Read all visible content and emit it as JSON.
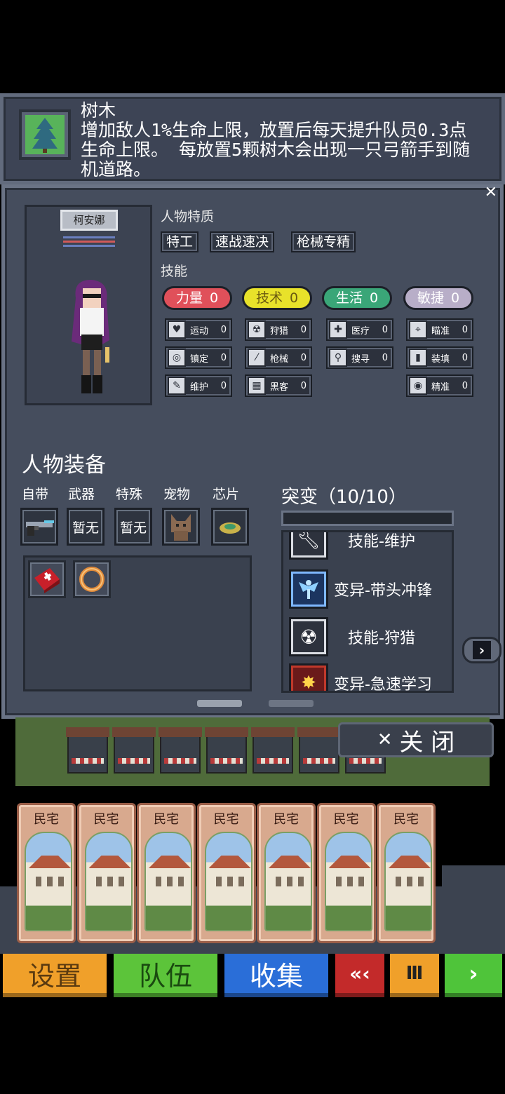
{
  "tooltip": {
    "icon": "tree-icon",
    "title": "树木",
    "description": "增加敌人1%生命上限，放置后每天提升队员0.3点生命上限。 每放置5颗树木会出现一只弓箭手到随机道路。"
  },
  "character": {
    "name": "柯安娜",
    "traits_label": "人物特质",
    "traits": [
      "特工",
      "速战速决",
      "枪械专精"
    ],
    "skills_label": "技能",
    "stats": [
      {
        "label": "力量",
        "value": "0",
        "color": "#e0505a"
      },
      {
        "label": "技术",
        "value": "0",
        "color": "#e8e22a"
      },
      {
        "label": "生活",
        "value": "0",
        "color": "#3aa678"
      },
      {
        "label": "敏捷",
        "value": "0",
        "color": "#b8aec8"
      }
    ],
    "skills": [
      {
        "label": "运动",
        "value": "0",
        "icon": "heart-icon",
        "glyph": "♥"
      },
      {
        "label": "狩猎",
        "value": "0",
        "icon": "radiation-icon",
        "glyph": "☢"
      },
      {
        "label": "医疗",
        "value": "0",
        "icon": "medkit-icon",
        "glyph": "✚"
      },
      {
        "label": "瞄准",
        "value": "0",
        "icon": "crosshair-icon",
        "glyph": "⌖"
      },
      {
        "label": "镇定",
        "value": "0",
        "icon": "glasses-icon",
        "glyph": "◎"
      },
      {
        "label": "枪械",
        "value": "0",
        "icon": "bullet-icon",
        "glyph": "⁄"
      },
      {
        "label": "搜寻",
        "value": "0",
        "icon": "magnifier-icon",
        "glyph": "⚲"
      },
      {
        "label": "装填",
        "value": "0",
        "icon": "magazine-icon",
        "glyph": "▮"
      },
      {
        "label": "维护",
        "value": "0",
        "icon": "wrench-icon",
        "glyph": "✎"
      },
      {
        "label": "黑客",
        "value": "0",
        "icon": "chip-icon",
        "glyph": "▦"
      },
      {
        "label": "精准",
        "value": "0",
        "icon": "eye-icon",
        "glyph": "◉"
      }
    ]
  },
  "equipment": {
    "title": "人物装备",
    "slot_labels": [
      "自带",
      "武器",
      "特殊",
      "宠物",
      "芯片"
    ],
    "slots": [
      {
        "icon": "gun-icon",
        "text": ""
      },
      {
        "icon": "",
        "text": "暂无"
      },
      {
        "icon": "",
        "text": "暂无"
      },
      {
        "icon": "cat-pet-icon",
        "text": ""
      },
      {
        "icon": "chip-item-icon",
        "text": ""
      }
    ],
    "inventory": [
      {
        "icon": "first-aid-kit-icon"
      },
      {
        "icon": "ring-icon"
      }
    ]
  },
  "mutations": {
    "title": "突变（10/10）",
    "items": [
      {
        "label": "技能-维护",
        "icon": "wrench-icon"
      },
      {
        "label": "变异-带头冲锋",
        "icon": "angel-icon"
      },
      {
        "label": "技能-狩猎",
        "icon": "radiation-icon"
      },
      {
        "label": "变异-急速学习",
        "icon": "burst-icon"
      }
    ]
  },
  "close_label": "关 闭",
  "cards": [
    "民宅",
    "民宅",
    "民宅",
    "民宅",
    "民宅",
    "民宅",
    "民宅"
  ],
  "bottom_bar": {
    "settings": "设置",
    "team": "队伍",
    "collect": "收集",
    "rewind": "«‹",
    "pause": "Ⅲ",
    "play": "›"
  }
}
